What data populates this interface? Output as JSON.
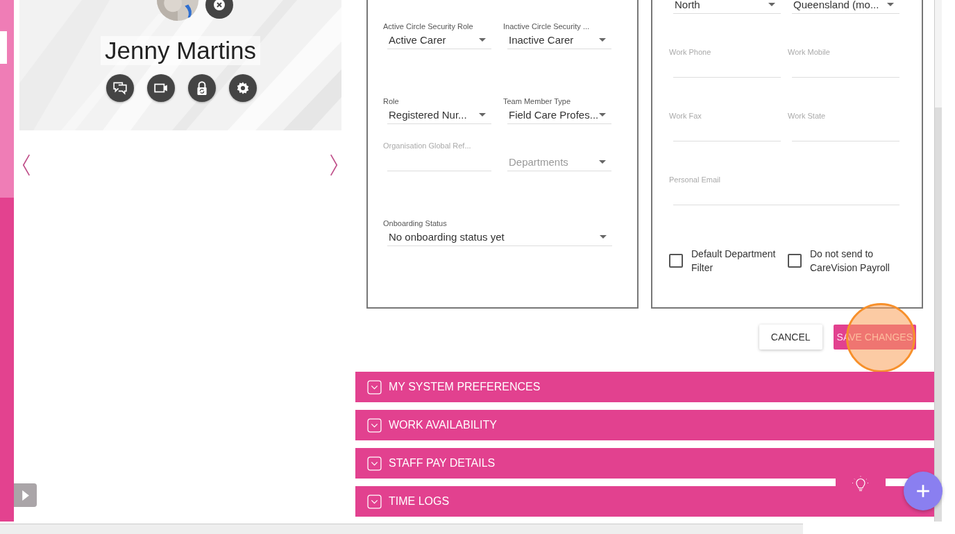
{
  "profile": {
    "name": "Jenny Martins",
    "actions": [
      {
        "kind": "chat"
      },
      {
        "kind": "video"
      },
      {
        "kind": "lock"
      },
      {
        "kind": "settings"
      }
    ]
  },
  "panels": [
    {
      "rows": [
        [
          {
            "kind": "select",
            "label": "Active Circle Security Role",
            "value": "Active Carer"
          },
          {
            "kind": "select",
            "label": "Inactive Circle Security ...",
            "value": "Inactive Carer"
          }
        ],
        [
          {
            "kind": "select",
            "label": "Role",
            "value": "Registered Nur..."
          },
          {
            "kind": "select",
            "label": "Team Member Type",
            "value": "Field Care Profes..."
          }
        ],
        [
          {
            "kind": "input",
            "label": "Organisation Global Ref..."
          },
          {
            "kind": "select",
            "placeholder": "Departments"
          }
        ],
        [
          {
            "kind": "select",
            "label": "Onboarding Status",
            "value": "No onboarding status yet"
          }
        ]
      ]
    },
    {
      "rows": [
        [
          {
            "kind": "select",
            "value": "North"
          },
          {
            "kind": "select",
            "value": "Queensland (mo..."
          }
        ],
        [
          {
            "kind": "input",
            "label": "Work Phone"
          },
          {
            "kind": "input",
            "label": "Work Mobile"
          }
        ],
        [
          {
            "kind": "input",
            "label": "Work Fax"
          },
          {
            "kind": "input",
            "label": "Work State"
          }
        ],
        [
          {
            "kind": "input",
            "label": "Personal Email"
          }
        ],
        [
          {
            "kind": "checkbox",
            "label": "Default Department Filter",
            "checked": false
          },
          {
            "kind": "checkbox",
            "label": "Do not send to CareVision Payroll",
            "checked": false
          }
        ]
      ]
    }
  ],
  "buttons": [
    {
      "label": "CANCEL",
      "kind": "secondary",
      "highlighted": false
    },
    {
      "label": "SAVE CHANGES",
      "kind": "primary",
      "highlighted": true
    }
  ],
  "sections": [
    {
      "title": "MY SYSTEM PREFERENCES",
      "expanded": false
    },
    {
      "title": "WORK AVAILABILITY",
      "expanded": false
    },
    {
      "title": "STAFF PAY DETAILS",
      "expanded": false
    },
    {
      "title": "TIME LOGS",
      "expanded": false
    }
  ]
}
